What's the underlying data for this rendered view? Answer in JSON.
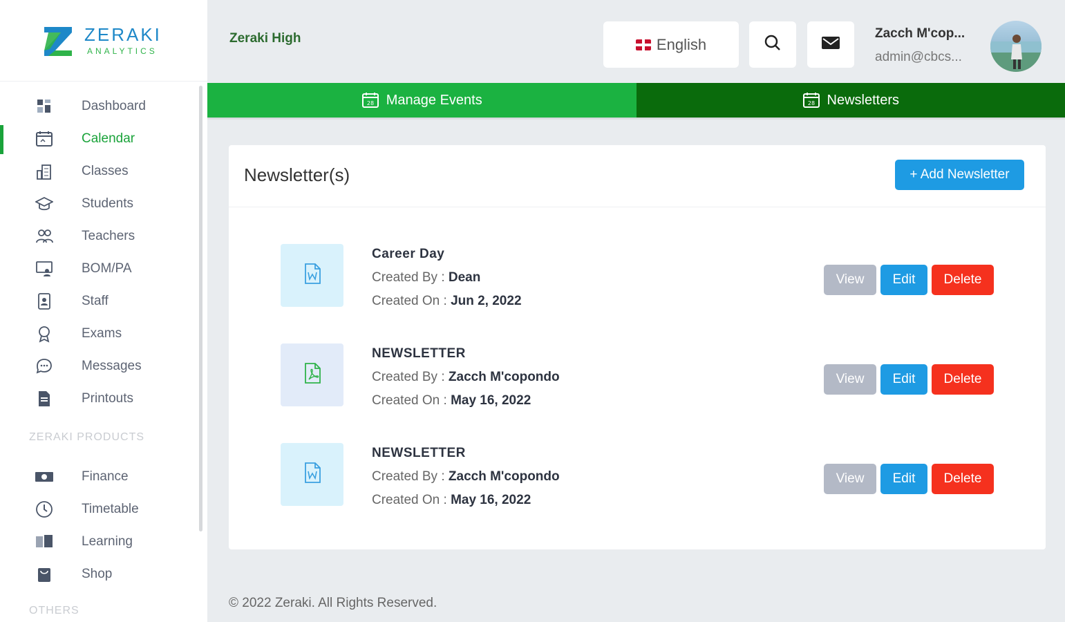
{
  "brand": {
    "name": "ZERAKI",
    "tagline": "ANALYTICS"
  },
  "sidebar": {
    "items": [
      {
        "label": "Dashboard",
        "icon": "dashboard-icon",
        "active": false
      },
      {
        "label": "Calendar",
        "icon": "calendar-icon",
        "active": true
      },
      {
        "label": "Classes",
        "icon": "building-icon",
        "active": false
      },
      {
        "label": "Students",
        "icon": "graduation-cap-icon",
        "active": false
      },
      {
        "label": "Teachers",
        "icon": "people-icon",
        "active": false
      },
      {
        "label": "BOM/PA",
        "icon": "presentation-icon",
        "active": false
      },
      {
        "label": "Staff",
        "icon": "id-badge-icon",
        "active": false
      },
      {
        "label": "Exams",
        "icon": "award-icon",
        "active": false
      },
      {
        "label": "Messages",
        "icon": "chat-icon",
        "active": false
      },
      {
        "label": "Printouts",
        "icon": "document-icon",
        "active": false
      }
    ],
    "products_title": "ZERAKI PRODUCTS",
    "products": [
      {
        "label": "Finance",
        "icon": "money-icon"
      },
      {
        "label": "Timetable",
        "icon": "clock-icon"
      },
      {
        "label": "Learning",
        "icon": "book-icon"
      },
      {
        "label": "Shop",
        "icon": "shopping-bag-icon"
      }
    ],
    "others_title": "OTHERS"
  },
  "header": {
    "school": "Zeraki High",
    "language": "English",
    "user_name": "Zacch M'cop...",
    "user_email": "admin@cbcs..."
  },
  "tabs": [
    {
      "label": "Manage Events"
    },
    {
      "label": "Newsletters"
    }
  ],
  "card": {
    "title": "Newsletter(s)",
    "add_label": "+ Add Newsletter",
    "created_by_label": "Created By : ",
    "created_on_label": "Created On : ",
    "view_label": "View",
    "edit_label": "Edit",
    "delete_label": "Delete",
    "rows": [
      {
        "name": "Career Day",
        "author": "Dean",
        "date": "Jun 2, 2022",
        "file_type": "word"
      },
      {
        "name": "NEWSLETTER",
        "author": "Zacch M'copondo",
        "date": "May 16, 2022",
        "file_type": "pdf"
      },
      {
        "name": "NEWSLETTER",
        "author": "Zacch M'copondo",
        "date": "May 16, 2022",
        "file_type": "word"
      }
    ]
  },
  "footer": {
    "text": "© 2022 Zeraki. All Rights Reserved."
  },
  "colors": {
    "green": "#1bb241",
    "dark_green": "#0a6b0c",
    "blue": "#1e9be3",
    "red": "#f5311e",
    "grey": "#b3b9c6"
  }
}
